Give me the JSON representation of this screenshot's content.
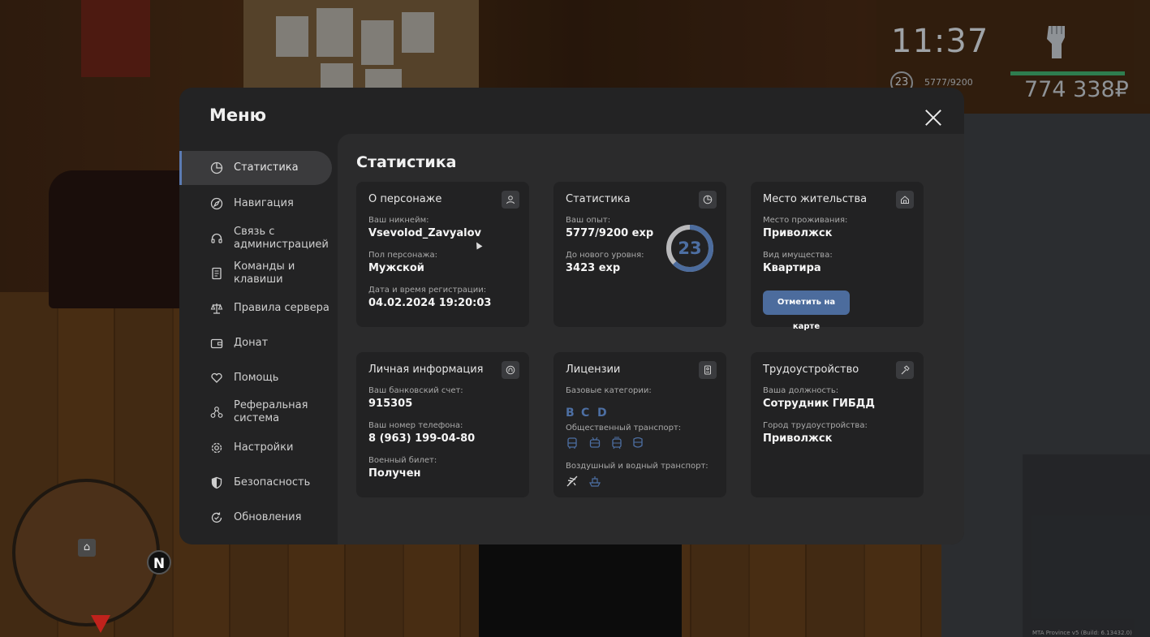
{
  "hud": {
    "time": "11:37",
    "level": "23",
    "exp": "5777/9200",
    "money": "774 338₽",
    "minimap_north": "N",
    "build": "MTA Province v5 (Build: 6.13432.0)"
  },
  "menu": {
    "title": "Меню",
    "sidebar": [
      {
        "label": "Статистика",
        "icon": "pie-chart-icon",
        "active": true
      },
      {
        "label": "Навигация",
        "icon": "compass-icon"
      },
      {
        "label": "Связь с администрацией",
        "icon": "headset-icon"
      },
      {
        "label": "Команды и клавиши",
        "icon": "document-icon"
      },
      {
        "label": "Правила сервера",
        "icon": "scales-icon"
      },
      {
        "label": "Донат",
        "icon": "wallet-icon"
      },
      {
        "label": "Помощь",
        "icon": "heart-hand-icon"
      },
      {
        "label": "Реферальная система",
        "icon": "network-icon"
      },
      {
        "label": "Настройки",
        "icon": "gear-icon"
      },
      {
        "label": "Безопасность",
        "icon": "shield-icon"
      },
      {
        "label": "Обновления",
        "icon": "refresh-icon"
      }
    ]
  },
  "content": {
    "title": "Статистика",
    "character": {
      "title": "О персонаже",
      "nickname_label": "Ваш никнейм:",
      "nickname": "Vsevolod_Zavyalov",
      "gender_label": "Пол персонажа:",
      "gender": "Мужской",
      "reg_label": "Дата и время регистрации:",
      "reg_date": "04.02.2024 19:20:03"
    },
    "stats": {
      "title": "Статистика",
      "exp_label": "Ваш опыт:",
      "exp": "5777/9200 exp",
      "next_label": "До нового уровня:",
      "next": "3423 exp",
      "level": "23",
      "progress": 0.628
    },
    "residence": {
      "title": "Место жительства",
      "place_label": "Место проживания:",
      "place": "Приволжск",
      "property_label": "Вид имущества:",
      "property": "Квартира",
      "map_button": "Отметить на карте"
    },
    "personal": {
      "title": "Личная информация",
      "bank_label": "Ваш банковский счет:",
      "bank": "915305",
      "phone_label": "Ваш номер телефона:",
      "phone": "8 (963) 199-04-80",
      "military_label": "Военный билет:",
      "military": "Получен"
    },
    "licenses": {
      "title": "Лицензии",
      "base_label": "Базовые категории:",
      "base": [
        "B",
        "C",
        "D"
      ],
      "public_label": "Общественный транспорт:",
      "public_icons": [
        "bus-icon",
        "trolleybus-icon",
        "tram-icon",
        "metro-icon"
      ],
      "air_label": "Воздушный и водный транспорт:",
      "air_icons": [
        "plane-icon",
        "boat-icon"
      ]
    },
    "job": {
      "title": "Трудоустройство",
      "position_label": "Ваша должность:",
      "position": "Сотрудник ГИБДД",
      "city_label": "Город трудоустройства:",
      "city": "Приволжск"
    }
  },
  "colors": {
    "accent": "#4c6c9d",
    "panel": "#232324",
    "card": "#222223"
  }
}
